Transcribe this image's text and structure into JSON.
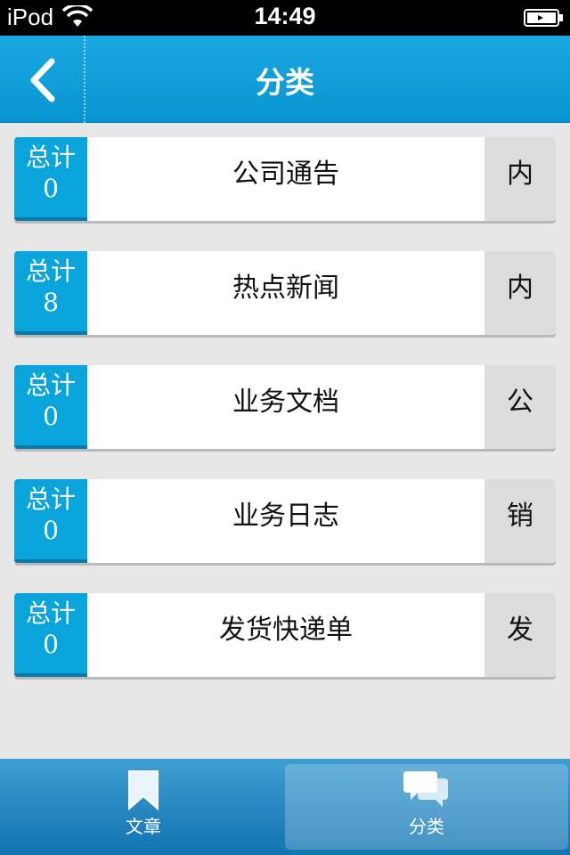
{
  "status_bar": {
    "carrier": "iPod",
    "time": "14:49"
  },
  "nav": {
    "title": "分类",
    "back_icon": "chevron-left-icon"
  },
  "categories": [
    {
      "count_label": "总计",
      "count": "0",
      "title": "公司通告",
      "tag": "内"
    },
    {
      "count_label": "总计",
      "count": "8",
      "title": "热点新闻",
      "tag": "内"
    },
    {
      "count_label": "总计",
      "count": "0",
      "title": "业务文档",
      "tag": "公"
    },
    {
      "count_label": "总计",
      "count": "0",
      "title": "业务日志",
      "tag": "销"
    },
    {
      "count_label": "总计",
      "count": "0",
      "title": "发货快递单",
      "tag": "发"
    }
  ],
  "tabs": [
    {
      "label": "文章",
      "icon": "bookmark-icon",
      "active": false
    },
    {
      "label": "分类",
      "icon": "chat-bubbles-icon",
      "active": true
    }
  ],
  "colors": {
    "nav_blue": "#0894d0",
    "count_blue": "#09a4dc",
    "tag_gray": "#dcdcdc",
    "background": "#e7e7e7"
  }
}
